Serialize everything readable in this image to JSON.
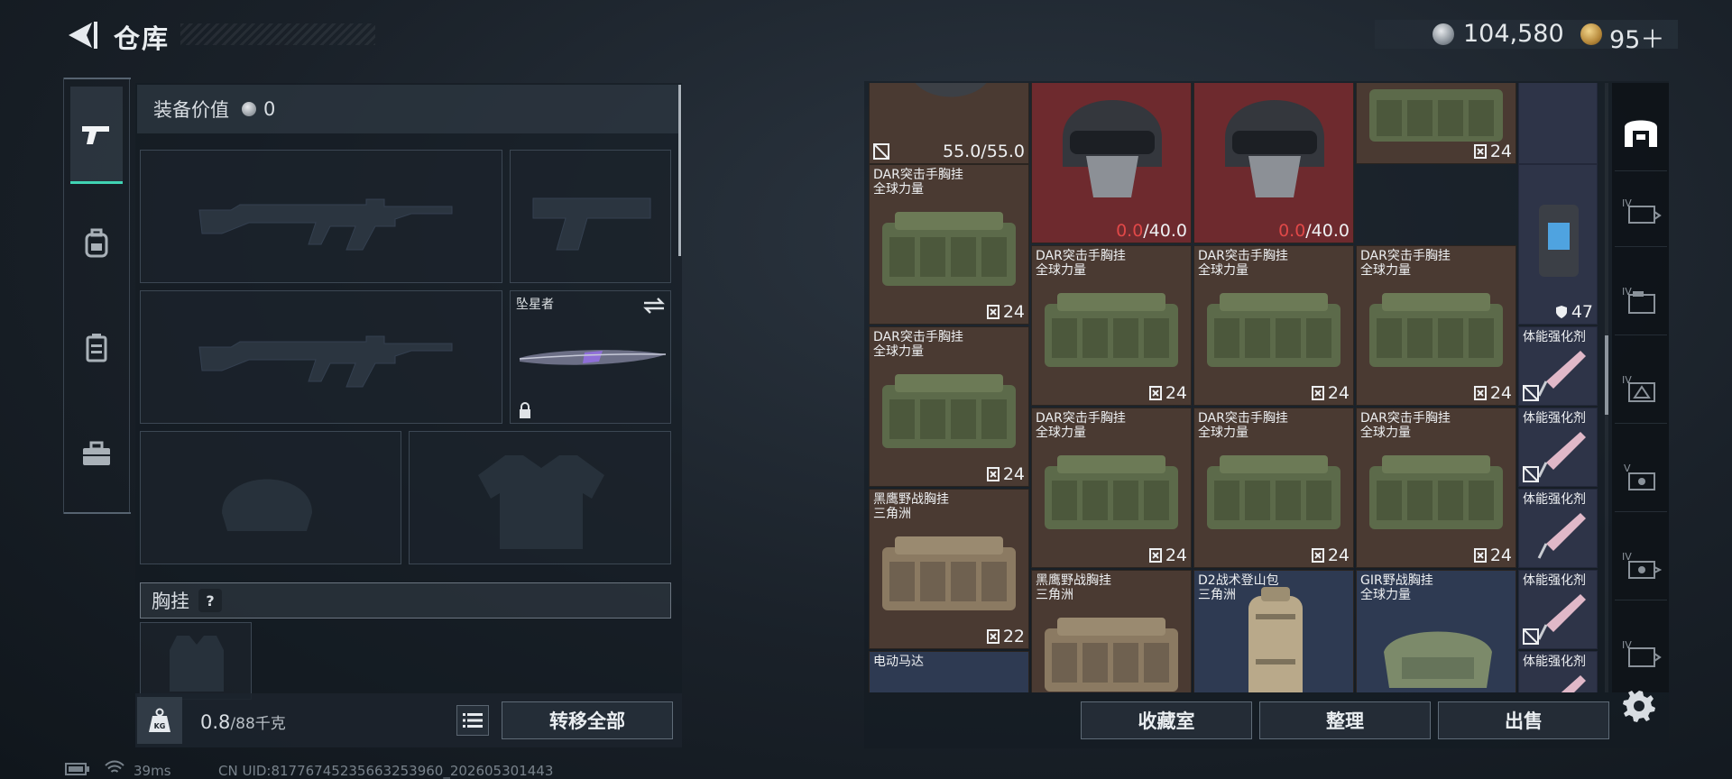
{
  "header": {
    "title": "仓库"
  },
  "currency": {
    "silver": "104,580",
    "gold": "95＋"
  },
  "loadout": {
    "equip_value_label": "装备价值",
    "equip_value": "0",
    "melee_name": "坠星者",
    "chest_label": "胸挂",
    "chest_help": "?",
    "weight_current": "0.8",
    "weight_max": "/88千克",
    "transfer_all": "转移全部"
  },
  "inventory": {
    "items": [
      {
        "name": "",
        "sub": "",
        "value": "55.0/55.0",
        "type": "helmet-top"
      },
      {
        "name": "DAR突击手胸挂",
        "sub": "全球力量",
        "value": "24",
        "type": "rig"
      },
      {
        "name": "",
        "sub": "",
        "value_low": "0.0",
        "value_max": "/40.0",
        "type": "helmet"
      },
      {
        "name": "",
        "sub": "",
        "value_low": "0.0",
        "value_max": "/40.0",
        "type": "helmet"
      },
      {
        "name": "",
        "sub": "",
        "value": "24",
        "type": "rig"
      },
      {
        "name": "",
        "sub": "",
        "value": "47",
        "type": "armor-plate"
      },
      {
        "name": "DAR突击手胸挂",
        "sub": "全球力量",
        "value": "24",
        "type": "rig"
      },
      {
        "name": "DAR突击手胸挂",
        "sub": "全球力量",
        "value": "24",
        "type": "rig"
      },
      {
        "name": "DAR突击手胸挂",
        "sub": "全球力量",
        "value": "24",
        "type": "rig"
      },
      {
        "name": "DAR突击手胸挂",
        "sub": "全球力量",
        "value": "24",
        "type": "rig"
      },
      {
        "name": "DAR突击手胸挂",
        "sub": "全球力量",
        "value": "24",
        "type": "rig"
      },
      {
        "name": "DAR突击手胸挂",
        "sub": "全球力量",
        "value": "24",
        "type": "rig"
      },
      {
        "name": "DAR突击手胸挂",
        "sub": "全球力量",
        "value": "24",
        "type": "rig"
      },
      {
        "name": "黑鹰野战胸挂",
        "sub": "三角洲",
        "value": "22",
        "type": "rig-tan"
      },
      {
        "name": "黑鹰野战胸挂",
        "sub": "三角洲",
        "value": "",
        "type": "rig-tan"
      },
      {
        "name": "D2战术登山包",
        "sub": "三角洲",
        "value": "",
        "type": "backpack"
      },
      {
        "name": "GIR野战胸挂",
        "sub": "全球力量",
        "value": "",
        "type": "rig-light"
      },
      {
        "name": "电动马达",
        "sub": "",
        "value": "",
        "type": "motor"
      },
      {
        "name": "体能强化剂",
        "type": "syringe"
      },
      {
        "name": "体能强化剂",
        "type": "syringe"
      },
      {
        "name": "体能强化剂",
        "type": "syringe"
      },
      {
        "name": "体能强化剂",
        "type": "syringe"
      },
      {
        "name": "体能强化剂",
        "type": "syringe"
      }
    ]
  },
  "actions": {
    "collection": "收藏室",
    "sort": "整理",
    "sell": "出售"
  },
  "side_rail": [
    "IV",
    "IV",
    "IV",
    "V",
    "IV",
    "IV"
  ],
  "status": {
    "ping": "39ms",
    "uid": "CN UID:8177674523566325396​0_202605301443"
  }
}
